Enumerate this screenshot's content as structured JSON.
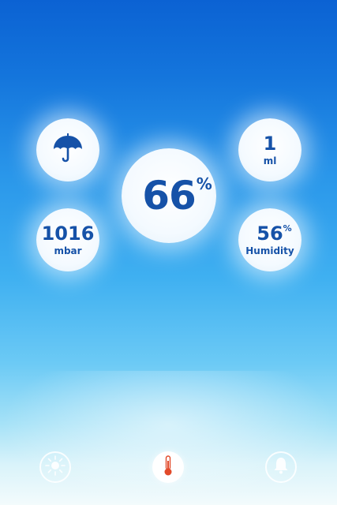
{
  "main": {
    "value": "66",
    "unit_symbol": "%"
  },
  "rain": {
    "icon": "umbrella-icon"
  },
  "precipitation": {
    "value": "1",
    "unit": "ml"
  },
  "pressure": {
    "value": "1016",
    "unit": "mbar"
  },
  "humidity": {
    "value": "56",
    "unit_symbol": "%",
    "label": "Humidity"
  },
  "footer": {
    "icons": [
      "sun-icon",
      "thermometer-icon",
      "bell-icon"
    ],
    "active": "thermometer-icon"
  },
  "colors": {
    "accent": "#1652a8",
    "sky_top": "#0b62d3",
    "sky_bottom": "#f3fbfc"
  }
}
